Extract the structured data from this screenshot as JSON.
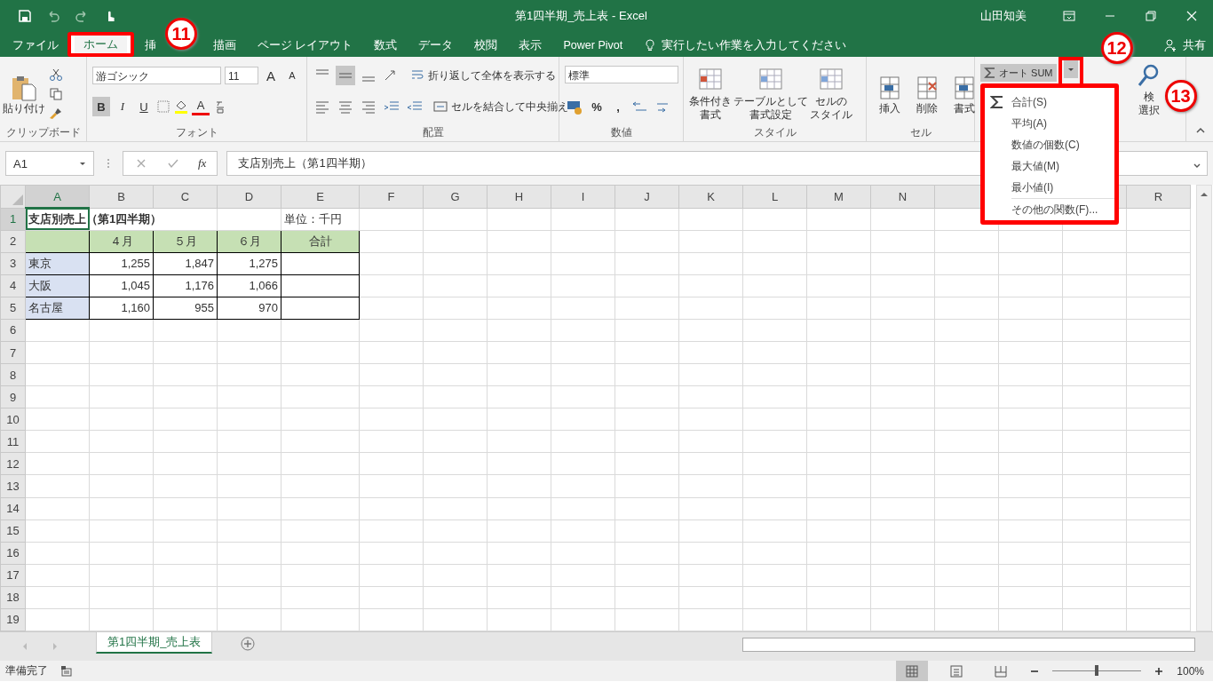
{
  "title_bar": {
    "title": "第1四半期_売上表  -  Excel",
    "user": "山田知美"
  },
  "menu_tabs": [
    {
      "label": "ファイル",
      "selected": false
    },
    {
      "label": "ホーム",
      "selected": true
    },
    {
      "label": "挿",
      "selected": false
    },
    {
      "label": "描画",
      "selected": false
    },
    {
      "label": "ページ レイアウト",
      "selected": false
    },
    {
      "label": "数式",
      "selected": false
    },
    {
      "label": "データ",
      "selected": false
    },
    {
      "label": "校閲",
      "selected": false
    },
    {
      "label": "表示",
      "selected": false
    },
    {
      "label": "Power Pivot",
      "selected": false
    }
  ],
  "tell_me": "実行したい作業を入力してください",
  "share": "共有",
  "ribbon": {
    "clipboard": {
      "paste": "貼り付け",
      "label": "クリップボード"
    },
    "font": {
      "name": "游ゴシック",
      "size": "11",
      "grow": "A",
      "shrink": "A",
      "styles": [
        {
          "label": "B",
          "kind": "bold",
          "selected": true
        },
        {
          "label": "I",
          "kind": "italic",
          "selected": false
        },
        {
          "label": "U",
          "kind": "underline",
          "selected": false
        }
      ],
      "color_letter": "A",
      "label": "フォント"
    },
    "alignment": {
      "vertical": [
        {
          "kind": "top",
          "selected": false
        },
        {
          "kind": "middle",
          "selected": true
        },
        {
          "kind": "bottom",
          "selected": false
        }
      ],
      "wrap": "折り返して全体を表示する",
      "merge": "セルを結合して中央揃え",
      "label": "配置"
    },
    "number": {
      "format": "標準",
      "percent": "%",
      "comma": ",",
      "label": "数値"
    },
    "styles": {
      "buttons": [
        {
          "lines": [
            "条件付き",
            "書式"
          ]
        },
        {
          "lines": [
            "テーブルとして",
            "書式設定"
          ]
        },
        {
          "lines": [
            "セルの",
            "スタイル"
          ]
        }
      ],
      "label": "スタイル"
    },
    "cells": {
      "buttons": [
        "挿入",
        "削除",
        "書式"
      ],
      "label": "セル"
    },
    "editing": {
      "autosum": "オート SUM",
      "find_lines": [
        "検",
        "選択"
      ]
    }
  },
  "autosum_menu": [
    {
      "label": "合計(S)",
      "kind": "sum"
    },
    {
      "label": "平均(A)",
      "kind": "plain"
    },
    {
      "label": "数値の個数(C)",
      "kind": "plain"
    },
    {
      "label": "最大値(M)",
      "kind": "plain"
    },
    {
      "label": "最小値(I)",
      "kind": "plain"
    },
    {
      "label": "その他の関数(F)...",
      "kind": "more"
    }
  ],
  "callouts": [
    {
      "number": "11"
    },
    {
      "number": "12"
    },
    {
      "number": "13"
    }
  ],
  "formula_bar": {
    "name_box": "A1",
    "fx": "fx",
    "formula": "支店別売上（第1四半期）"
  },
  "sheet": {
    "columns": [
      {
        "label": "A",
        "selected": true
      },
      {
        "label": "B",
        "selected": false
      },
      {
        "label": "C",
        "selected": false
      },
      {
        "label": "D",
        "selected": false
      },
      {
        "label": "E",
        "selected": false
      },
      {
        "label": "F",
        "selected": false
      },
      {
        "label": "G",
        "selected": false
      },
      {
        "label": "H",
        "selected": false
      },
      {
        "label": "I",
        "selected": false
      },
      {
        "label": "J",
        "selected": false
      },
      {
        "label": "K",
        "selected": false
      },
      {
        "label": "L",
        "selected": false
      },
      {
        "label": "M",
        "selected": false
      },
      {
        "label": "N",
        "selected": false
      },
      null,
      null,
      null,
      {
        "label": "R",
        "selected": false
      }
    ],
    "rows": [
      {
        "number": "1",
        "selected": true,
        "cells": [
          {
            "text": "支店別売上（第1四半期）",
            "kind": "title"
          },
          {
            "kind": "spill"
          },
          {
            "kind": "spill"
          },
          {
            "kind": "blank"
          },
          {
            "text": "単位：千円",
            "kind": "plain"
          }
        ]
      },
      {
        "number": "2",
        "selected": false,
        "cells": [
          {
            "kind": "head"
          },
          {
            "text": "４月",
            "kind": "head"
          },
          {
            "text": "５月",
            "kind": "head"
          },
          {
            "text": "６月",
            "kind": "head"
          },
          {
            "text": "合計",
            "kind": "head"
          }
        ]
      },
      {
        "number": "3",
        "selected": false,
        "cells": [
          {
            "text": "東京",
            "kind": "label"
          },
          {
            "text": "1,255",
            "kind": "num"
          },
          {
            "text": "1,847",
            "kind": "num"
          },
          {
            "text": "1,275",
            "kind": "num"
          },
          {
            "kind": "total"
          }
        ]
      },
      {
        "number": "4",
        "selected": false,
        "cells": [
          {
            "text": "大阪",
            "kind": "label"
          },
          {
            "text": "1,045",
            "kind": "num"
          },
          {
            "text": "1,176",
            "kind": "num"
          },
          {
            "text": "1,066",
            "kind": "num"
          },
          {
            "kind": "total"
          }
        ]
      },
      {
        "number": "5",
        "selected": false,
        "cells": [
          {
            "text": "名古屋",
            "kind": "label"
          },
          {
            "text": "1,160",
            "kind": "num"
          },
          {
            "text": "955",
            "kind": "num"
          },
          {
            "text": "970",
            "kind": "num"
          },
          {
            "kind": "total"
          }
        ]
      },
      {
        "number": "6",
        "selected": false
      },
      {
        "number": "7",
        "selected": false
      },
      {
        "number": "8",
        "selected": false
      },
      {
        "number": "9",
        "selected": false
      },
      {
        "number": "10",
        "selected": false
      },
      {
        "number": "11",
        "selected": false
      },
      {
        "number": "12",
        "selected": false
      },
      {
        "number": "13",
        "selected": false
      },
      {
        "number": "14",
        "selected": false
      },
      {
        "number": "15",
        "selected": false
      },
      {
        "number": "16",
        "selected": false
      },
      {
        "number": "17",
        "selected": false
      },
      {
        "number": "18",
        "selected": false
      },
      {
        "number": "19",
        "selected": false
      }
    ]
  },
  "sheet_tabs": [
    {
      "label": "第1四半期_売上表",
      "selected": true
    }
  ],
  "status_bar": {
    "text": "準備完了",
    "views": [
      {
        "kind": "normal",
        "selected": true
      },
      {
        "kind": "page_layout",
        "selected": false
      },
      {
        "kind": "page_break",
        "selected": false
      }
    ],
    "zoom": {
      "level": 0.5
    },
    "zoom_text": "100%"
  }
}
